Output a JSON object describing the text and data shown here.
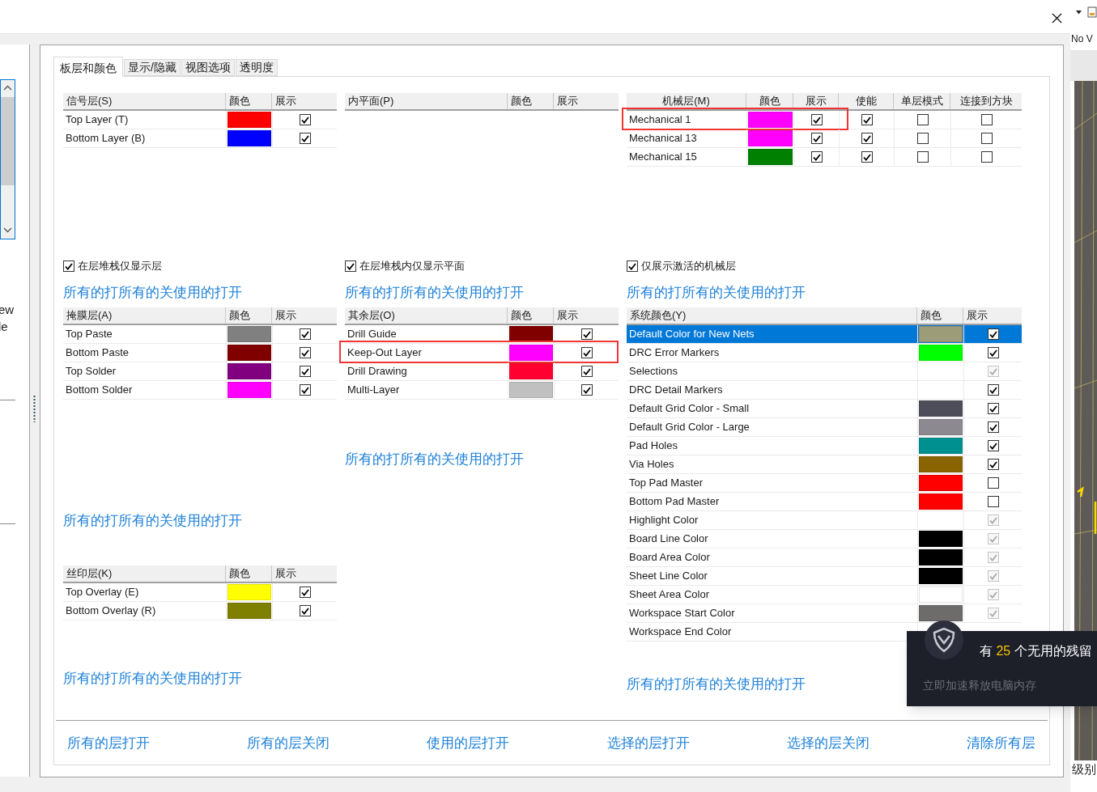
{
  "tabs": [
    {
      "label": "板层和颜色",
      "selected": true
    },
    {
      "label": "显示/隐藏",
      "selected": false
    },
    {
      "label": "视图选项",
      "selected": false
    },
    {
      "label": "透明度",
      "selected": false
    }
  ],
  "columns": [
    {
      "sections": [
        {
          "kind": "table",
          "headers": [
            "信号层(S)",
            "颜色",
            "展示"
          ],
          "rows": [
            {
              "name": "Top Layer (T)",
              "color": "#ff0000",
              "checks": [
                {
                  "checked": true,
                  "disabled": false
                }
              ]
            },
            {
              "name": "Bottom Layer (B)",
              "color": "#0000ff",
              "checks": [
                {
                  "checked": true,
                  "disabled": false
                }
              ]
            }
          ]
        },
        {
          "kind": "checkbox",
          "label": "在层堆栈仅显示层",
          "checked": true
        },
        {
          "kind": "links",
          "items": [
            "所有的打",
            "所有的关",
            "使用的打开"
          ]
        },
        {
          "kind": "table",
          "headers": [
            "掩膜层(A)",
            "颜色",
            "展示"
          ],
          "rows": [
            {
              "name": "Top Paste",
              "color": "#808080",
              "checks": [
                {
                  "checked": true,
                  "disabled": false
                }
              ]
            },
            {
              "name": "Bottom Paste",
              "color": "#800000",
              "checks": [
                {
                  "checked": true,
                  "disabled": false
                }
              ]
            },
            {
              "name": "Top Solder",
              "color": "#800080",
              "checks": [
                {
                  "checked": true,
                  "disabled": false
                }
              ]
            },
            {
              "name": "Bottom Solder",
              "color": "#ff00ff",
              "checks": [
                {
                  "checked": true,
                  "disabled": false
                }
              ]
            }
          ]
        },
        {
          "kind": "links",
          "items": [
            "所有的打",
            "所有的关",
            "使用的打开"
          ]
        },
        {
          "kind": "table",
          "headers": [
            "丝印层(K)",
            "颜色",
            "展示"
          ],
          "rows": [
            {
              "name": "Top Overlay (E)",
              "color": "#ffff00",
              "checks": [
                {
                  "checked": true,
                  "disabled": false
                }
              ]
            },
            {
              "name": "Bottom Overlay (R)",
              "color": "#808000",
              "checks": [
                {
                  "checked": true,
                  "disabled": false
                }
              ]
            }
          ]
        },
        {
          "kind": "links",
          "items": [
            "所有的打",
            "所有的关",
            "使用的打开"
          ]
        }
      ]
    },
    {
      "sections": [
        {
          "kind": "table",
          "headers": [
            "内平面(P)",
            "颜色",
            "展示"
          ]
        },
        {
          "kind": "checkbox",
          "label": "在层堆栈内仅显示平面",
          "checked": true
        },
        {
          "kind": "links",
          "items": [
            "所有的打",
            "所有的关",
            "使用的打开"
          ]
        },
        {
          "kind": "table",
          "headers": [
            "其余层(O)",
            "颜色",
            "展示"
          ],
          "rows": [
            {
              "name": "Drill Guide",
              "color": "#800000",
              "checks": [
                {
                  "checked": true,
                  "disabled": false
                }
              ],
              "highlighted": false
            },
            {
              "name": "Keep-Out Layer",
              "color": "#ff00ff",
              "checks": [
                {
                  "checked": true,
                  "disabled": false
                }
              ],
              "highlighted": true
            },
            {
              "name": "Drill Drawing",
              "color": "#ff0030",
              "checks": [
                {
                  "checked": true,
                  "disabled": false
                }
              ],
              "highlighted": false
            },
            {
              "name": "Multi-Layer",
              "color": "#c0c0c0",
              "checks": [
                {
                  "checked": true,
                  "disabled": false
                }
              ],
              "highlighted": false
            }
          ]
        },
        {
          "kind": "links",
          "items": [
            "所有的打",
            "所有的关",
            "使用的打开"
          ]
        }
      ]
    },
    {
      "sections": [
        {
          "kind": "table",
          "headers": [
            "机械层(M)",
            "颜色",
            "展示",
            "使能",
            "单层模式",
            "连接到方块"
          ],
          "rows": [
            {
              "name": "Mechanical 1",
              "color": "#ff00ff",
              "checks": [
                {
                  "checked": true,
                  "disabled": false
                },
                {
                  "checked": true,
                  "disabled": false
                },
                {
                  "checked": false,
                  "disabled": false
                },
                {
                  "checked": false,
                  "disabled": false
                }
              ],
              "highlighted": true
            },
            {
              "name": "Mechanical 13",
              "color": "#ff00ff",
              "checks": [
                {
                  "checked": true,
                  "disabled": false
                },
                {
                  "checked": true,
                  "disabled": false
                },
                {
                  "checked": false,
                  "disabled": false
                },
                {
                  "checked": false,
                  "disabled": false
                }
              ],
              "highlighted": false
            },
            {
              "name": "Mechanical 15",
              "color": "#008000",
              "checks": [
                {
                  "checked": true,
                  "disabled": false
                },
                {
                  "checked": true,
                  "disabled": false
                },
                {
                  "checked": false,
                  "disabled": false
                },
                {
                  "checked": false,
                  "disabled": false
                }
              ],
              "highlighted": false
            }
          ]
        },
        {
          "kind": "checkbox",
          "label": "仅展示激活的机械层",
          "checked": true
        },
        {
          "kind": "links",
          "items": [
            "所有的打",
            "所有的关",
            "使用的打开"
          ]
        },
        {
          "kind": "table",
          "headers": [
            "系统颜色(Y)",
            "颜色",
            "展示"
          ],
          "rows": [
            {
              "name": "Default Color for New Nets",
              "color": "#9c9c78",
              "checks": [
                {
                  "checked": true,
                  "disabled": false
                }
              ],
              "selected": true
            },
            {
              "name": "DRC Error Markers",
              "color": "#00ff00",
              "checks": [
                {
                  "checked": true,
                  "disabled": false
                }
              ],
              "selected": false
            },
            {
              "name": "Selections",
              "checks": [
                {
                  "checked": true,
                  "disabled": true
                }
              ],
              "selected": false
            },
            {
              "name": "DRC Detail Markers",
              "checks": [
                {
                  "checked": true,
                  "disabled": false
                }
              ],
              "selected": false
            },
            {
              "name": "Default Grid Color - Small",
              "color": "#4e4e5a",
              "checks": [
                {
                  "checked": true,
                  "disabled": false
                }
              ],
              "selected": false
            },
            {
              "name": "Default Grid Color - Large",
              "color": "#8c8a90",
              "checks": [
                {
                  "checked": true,
                  "disabled": false
                }
              ],
              "selected": false
            },
            {
              "name": "Pad Holes",
              "color": "#009090",
              "checks": [
                {
                  "checked": true,
                  "disabled": false
                }
              ],
              "selected": false
            },
            {
              "name": "Via Holes",
              "color": "#8a6400",
              "checks": [
                {
                  "checked": true,
                  "disabled": false
                }
              ],
              "selected": false
            },
            {
              "name": "Top Pad Master",
              "color": "#ff0000",
              "checks": [
                {
                  "checked": false,
                  "disabled": false
                }
              ],
              "selected": false
            },
            {
              "name": "Bottom Pad Master",
              "color": "#ff0000",
              "checks": [
                {
                  "checked": false,
                  "disabled": false
                }
              ],
              "selected": false
            },
            {
              "name": "Highlight Color",
              "checks": [
                {
                  "checked": true,
                  "disabled": true
                }
              ],
              "selected": false
            },
            {
              "name": "Board Line Color",
              "color": "#000000",
              "checks": [
                {
                  "checked": true,
                  "disabled": true
                }
              ],
              "selected": false
            },
            {
              "name": "Board Area Color",
              "color": "#000000",
              "checks": [
                {
                  "checked": true,
                  "disabled": true
                }
              ],
              "selected": false
            },
            {
              "name": "Sheet Line Color",
              "color": "#000000",
              "checks": [
                {
                  "checked": true,
                  "disabled": true
                }
              ],
              "selected": false
            },
            {
              "name": "Sheet Area Color",
              "color": "#ffffff",
              "checks": [
                {
                  "checked": true,
                  "disabled": true
                }
              ],
              "selected": false
            },
            {
              "name": "Workspace Start Color",
              "color": "#6e6b6b",
              "checks": [
                {
                  "checked": true,
                  "disabled": true
                }
              ],
              "selected": false
            },
            {
              "name": "Workspace End Color",
              "selected": false
            }
          ]
        },
        {
          "kind": "links",
          "items": [
            "所有的打",
            "所有的关",
            "使用的打开"
          ]
        }
      ]
    }
  ],
  "bottom_links": [
    "所有的层打开",
    "所有的层关闭",
    "使用的层打开",
    "选择的层打开",
    "选择的层关闭",
    "清除所有层"
  ],
  "left_pane": {
    "lines": [
      "ew",
      "le"
    ]
  },
  "right_pane": {
    "top_text": "No V",
    "bottom_text": "级别"
  },
  "popup": {
    "prefix": "有",
    "count": "25",
    "suffix": "个无用的残留",
    "subtitle": "立即加速释放电脑内存"
  }
}
